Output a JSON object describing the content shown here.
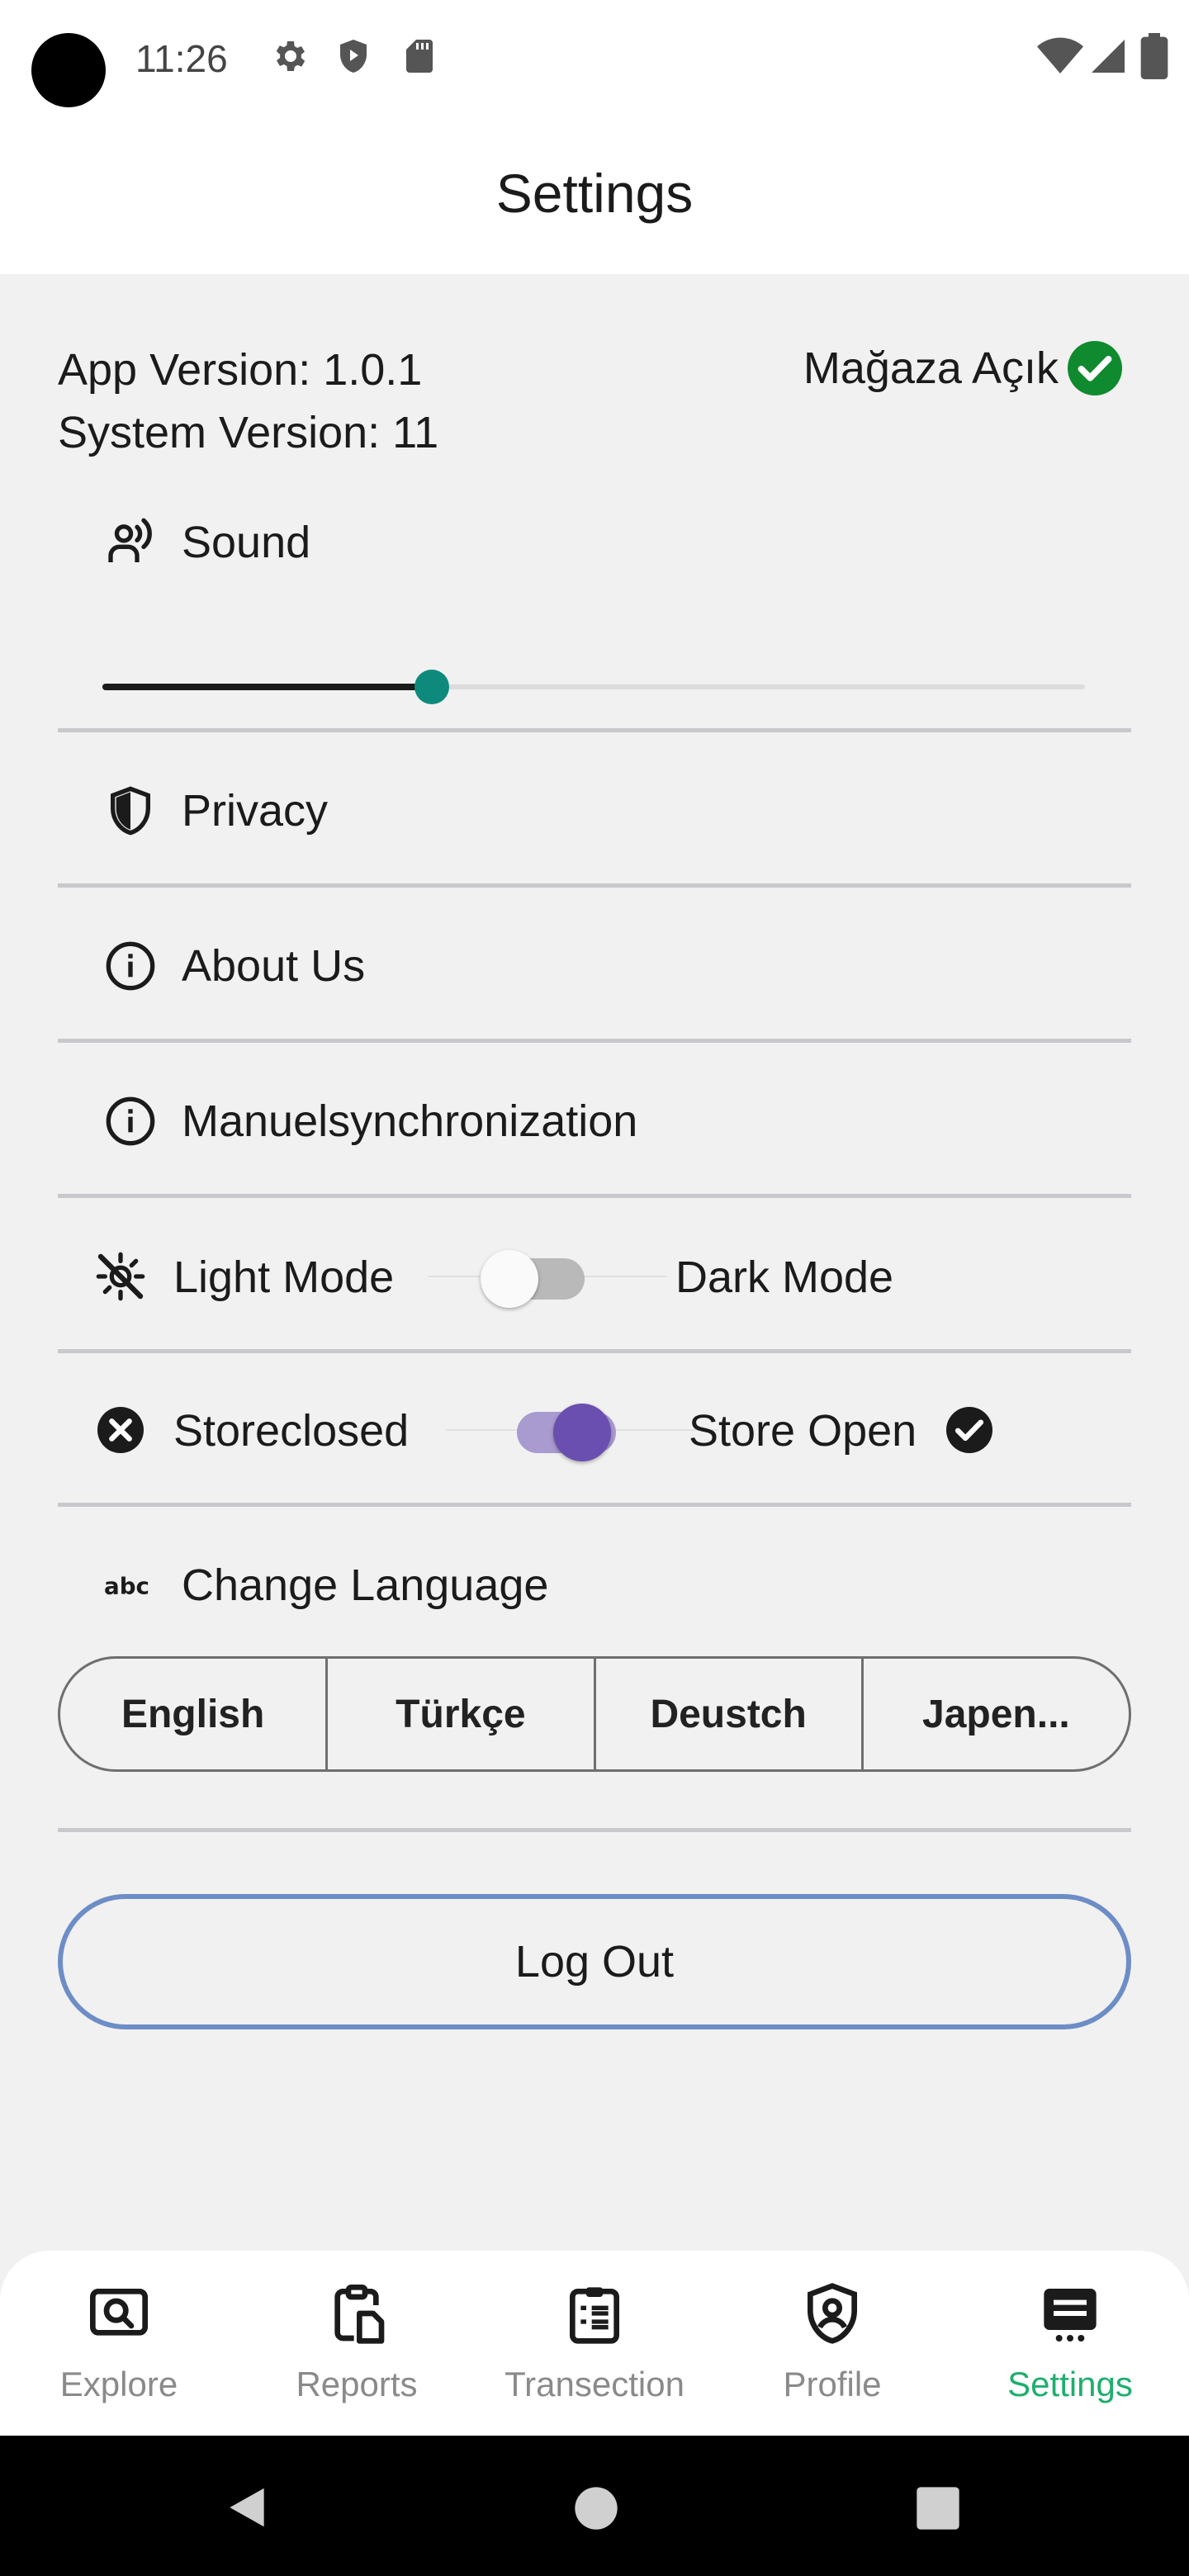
{
  "status_bar": {
    "time": "11:26"
  },
  "app_bar": {
    "title": "Settings"
  },
  "info": {
    "app_version": "App Version: 1.0.1",
    "system_version": "System Version: 11",
    "store_status": "Mağaza Açık"
  },
  "sound": {
    "label": "Sound",
    "level": 0.335
  },
  "menu": {
    "privacy": "Privacy",
    "about": "About Us",
    "sync": "Manuelsynchronization"
  },
  "theme_toggle": {
    "left_label": "Light Mode",
    "right_label": "Dark Mode",
    "on": false
  },
  "store_toggle": {
    "left_label": "Storeclosed",
    "right_label": "Store Open",
    "on": true
  },
  "language": {
    "label": "Change Language",
    "options": [
      "English",
      "Türkçe",
      "Deustch",
      "Japen..."
    ]
  },
  "logout_label": "Log Out",
  "bottom_nav": {
    "items": [
      {
        "label": "Explore",
        "icon": "explore-icon"
      },
      {
        "label": "Reports",
        "icon": "reports-icon"
      },
      {
        "label": "Transection",
        "icon": "transaction-icon"
      },
      {
        "label": "Profile",
        "icon": "profile-icon"
      },
      {
        "label": "Settings",
        "icon": "settings-icon",
        "active": true
      }
    ]
  },
  "colors": {
    "accent_green": "#1fae6e",
    "slider_thumb": "#0d8a7c",
    "toggle_purple": "#6a4fb0",
    "logout_border": "#6d8dc6",
    "check_green": "#0f8a2e"
  }
}
